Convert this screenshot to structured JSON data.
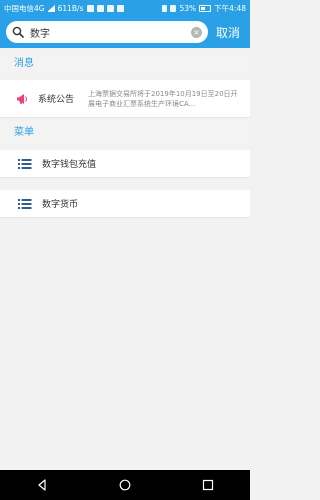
{
  "status_bar": {
    "carrier": "中国电信4G",
    "speed": "611B/s",
    "battery": "53%",
    "time": "下午4:48"
  },
  "search": {
    "query": "数字",
    "cancel_label": "取消"
  },
  "sections": {
    "messages_title": "消息",
    "menu_title": "菜单"
  },
  "notice": {
    "label": "系统公告",
    "text": "上海票据交易所将于2019年10月19日至20日开展电子商业汇票系统生产环境CA..."
  },
  "menu_items": [
    {
      "label": "数字钱包充值"
    },
    {
      "label": "数字货币"
    }
  ],
  "colors": {
    "accent": "#2aa0e6",
    "notice_icon": "#e8447a",
    "menu_icon": "#2f5d8c"
  }
}
